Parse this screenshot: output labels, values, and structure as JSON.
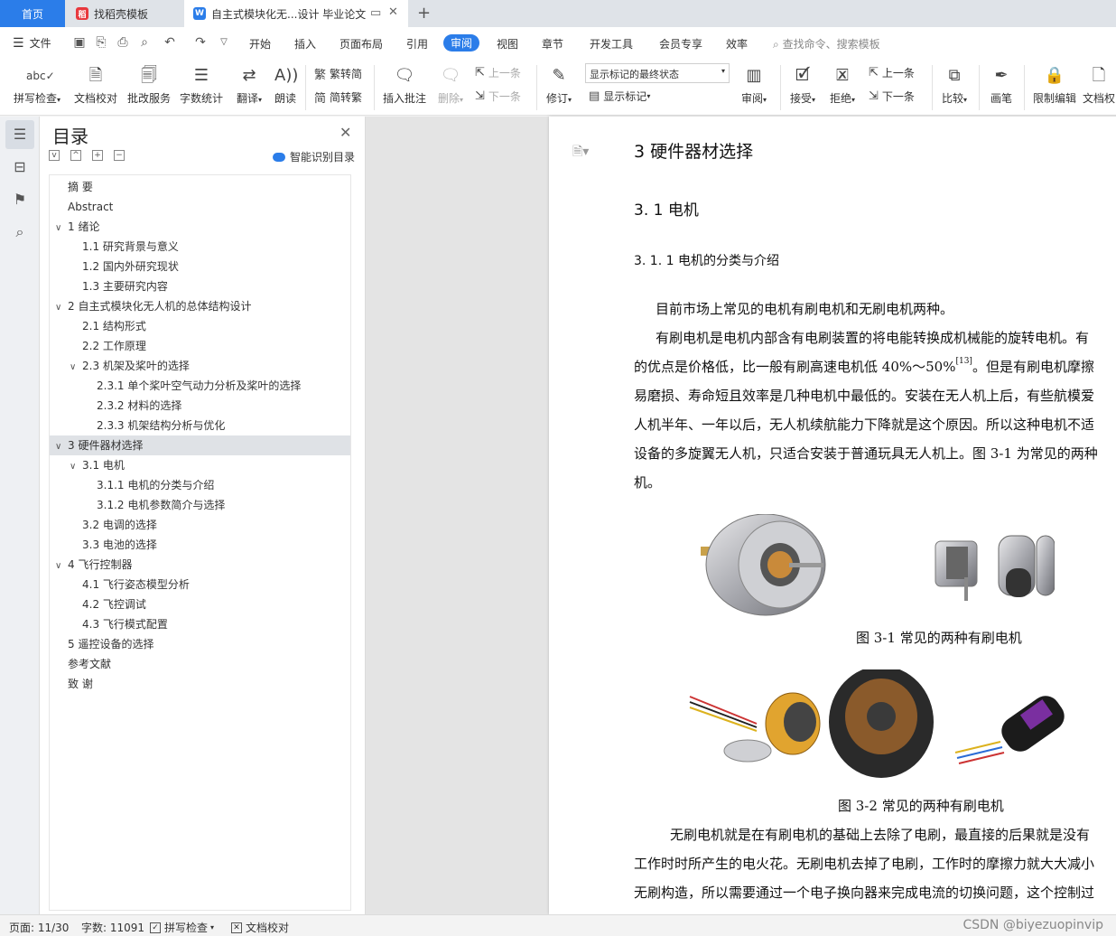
{
  "tabs": {
    "home": "首页",
    "template": "找稻壳模板",
    "document": "自主式模块化无...设计 毕业论文"
  },
  "menu": {
    "file": "文件",
    "items": [
      "开始",
      "插入",
      "页面布局",
      "引用",
      "审阅",
      "视图",
      "章节",
      "开发工具",
      "会员专享",
      "效率"
    ],
    "active": "审阅",
    "search_placeholder": "查找命令、搜索模板"
  },
  "ribbon": {
    "spell_check": "拼写检查",
    "doc_proof": "文档校对",
    "revise_service": "批改服务",
    "word_count": "字数统计",
    "translate": "翻译",
    "read_aloud": "朗读",
    "to_traditional": "繁转简",
    "to_simplified": "简转繁",
    "insert_comment": "插入批注",
    "delete": "删除",
    "prev_comment": "上一条",
    "next_comment": "下一条",
    "revise": "修订",
    "markup_state": "显示标记的最终状态",
    "show_markup": "显示标记",
    "review": "审阅",
    "accept": "接受",
    "reject": "拒绝",
    "prev_change": "上一条",
    "next_change": "下一条",
    "compare": "比较",
    "pen": "画笔",
    "restrict_edit": "限制编辑",
    "doc_auth": "文档权"
  },
  "toc": {
    "title": "目录",
    "smart_recognize": "智能识别目录",
    "items": [
      {
        "label": "摘  要",
        "level": 0,
        "caret": ""
      },
      {
        "label": "Abstract",
        "level": 0,
        "caret": ""
      },
      {
        "label": "1  绪论",
        "level": 0,
        "caret": "v"
      },
      {
        "label": "1.1  研究背景与意义",
        "level": 1,
        "caret": ""
      },
      {
        "label": "1.2  国内外研究现状",
        "level": 1,
        "caret": ""
      },
      {
        "label": "1.3  主要研究内容",
        "level": 1,
        "caret": ""
      },
      {
        "label": "2 自主式模块化无人机的总体结构设计",
        "level": 0,
        "caret": "v"
      },
      {
        "label": "2.1 结构形式",
        "level": 1,
        "caret": ""
      },
      {
        "label": "2.2 工作原理",
        "level": 1,
        "caret": ""
      },
      {
        "label": "2.3 机架及桨叶的选择",
        "level": 1,
        "caret": "v"
      },
      {
        "label": "2.3.1 单个桨叶空气动力分析及桨叶的选择",
        "level": 2,
        "caret": ""
      },
      {
        "label": "2.3.2 材料的选择",
        "level": 2,
        "caret": ""
      },
      {
        "label": "2.3.3 机架结构分析与优化",
        "level": 2,
        "caret": ""
      },
      {
        "label": "3 硬件器材选择",
        "level": 0,
        "caret": "v"
      },
      {
        "label": "3.1 电机",
        "level": 1,
        "caret": "v"
      },
      {
        "label": "3.1.1 电机的分类与介绍",
        "level": 2,
        "caret": ""
      },
      {
        "label": "3.1.2 电机参数简介与选择",
        "level": 2,
        "caret": ""
      },
      {
        "label": "3.2 电调的选择",
        "level": 1,
        "caret": ""
      },
      {
        "label": "3.3 电池的选择",
        "level": 1,
        "caret": ""
      },
      {
        "label": "4 飞行控制器",
        "level": 0,
        "caret": "v"
      },
      {
        "label": "4.1 飞行姿态模型分析",
        "level": 1,
        "caret": ""
      },
      {
        "label": "4.2 飞控调试",
        "level": 1,
        "caret": ""
      },
      {
        "label": "4.3 飞行模式配置",
        "level": 1,
        "caret": ""
      },
      {
        "label": "5 遥控设备的选择",
        "level": 0,
        "caret": ""
      },
      {
        "label": "参考文献",
        "level": 0,
        "caret": ""
      },
      {
        "label": "致    谢",
        "level": 0,
        "caret": ""
      }
    ],
    "selected_index": 13
  },
  "document": {
    "h1": "3 硬件器材选择",
    "h2": "3. 1 电机",
    "h3": "3. 1. 1 电机的分类与介绍",
    "p1": "目前市场上常见的电机有刷电机和无刷电机两种。",
    "p2_l1": "有刷电机是电机内部含有电刷装置的将电能转换成机械能的旋转电机。有",
    "p2_l2a": "的优点是价格低，比一般有刷高速电机低 40%～50%",
    "p2_l2_ref": "[13]",
    "p2_l2b": "。但是有刷电机摩擦",
    "p2_l3": "易磨损、寿命短且效率是几种电机中最低的。安装在无人机上后，有些航模爱",
    "p2_l4": "人机半年、一年以后，无人机续航能力下降就是这个原因。所以这种电机不适",
    "p2_l5": "设备的多旋翼无人机，只适合安装于普通玩具无人机上。图 3-1 为常见的两种",
    "p2_l6": "机。",
    "fig1_caption": "图 3-1 常见的两种有刷电机",
    "fig2_caption": "图 3-2  常见的两种有刷电机",
    "p3_l1": "无刷电机就是在有刷电机的基础上去除了电刷，最直接的后果就是没有",
    "p3_l2": "工作时时所产生的电火花。无刷电机去掉了电刷，工作时的摩擦力就大大减小",
    "p3_l3": "无刷构造，所以需要通过一个电子换向器来完成电流的切换问题，这个控制过"
  },
  "status": {
    "page": "页面: 11/30",
    "words": "字数: 11091",
    "spell": "拼写检查",
    "proof": "文档校对",
    "watermark": "CSDN @biyezuopinvip"
  }
}
